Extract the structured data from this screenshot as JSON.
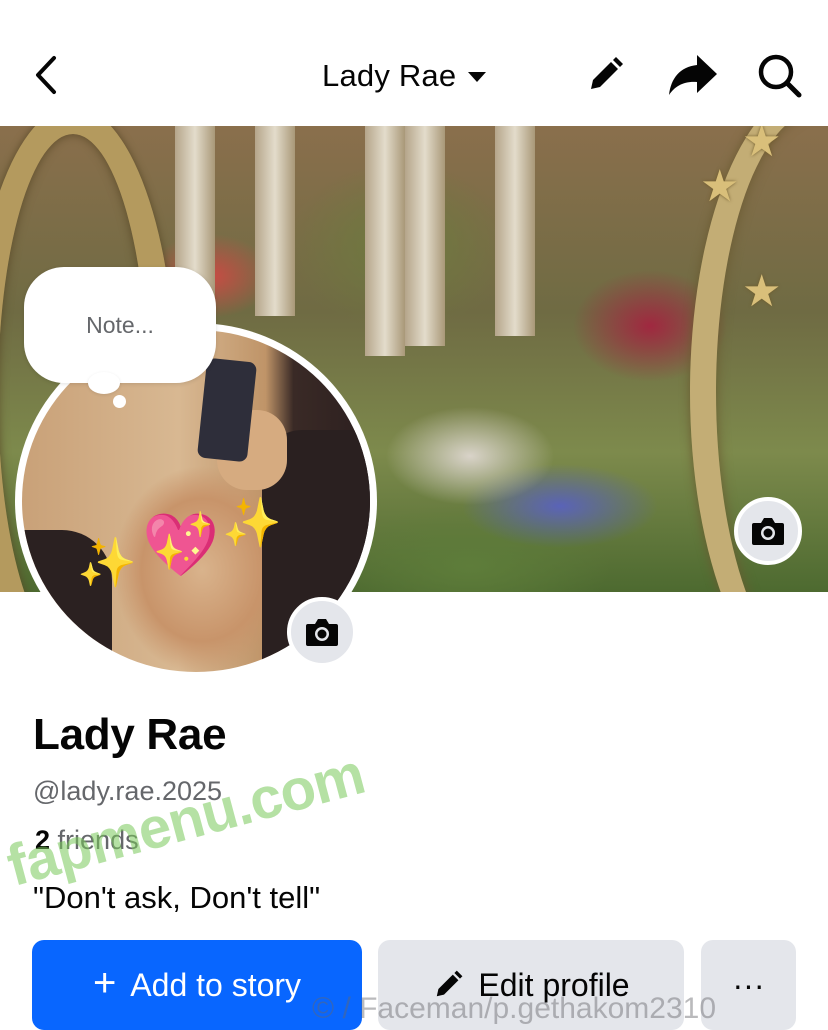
{
  "header": {
    "title": "Lady Rae",
    "back_icon": "chevron-left-icon",
    "edit_icon": "pencil-icon",
    "share_icon": "share-arrow-icon",
    "search_icon": "search-icon"
  },
  "note": {
    "placeholder": "Note..."
  },
  "profile": {
    "name": "Lady Rae",
    "handle": "@lady.rae.2025",
    "friends_count": "2",
    "friends_label": "friends",
    "bio": "\"Don't ask, Don't tell\""
  },
  "actions": {
    "add_story_label": "Add to story",
    "edit_profile_label": "Edit profile",
    "more_label": "···"
  },
  "watermark": {
    "text": "fapmenu.com",
    "tail": "© / Faceman/p.gethakom2310"
  },
  "colors": {
    "primary": "#0866ff",
    "secondary_button": "#e4e6eb",
    "muted_text": "#65676b"
  }
}
